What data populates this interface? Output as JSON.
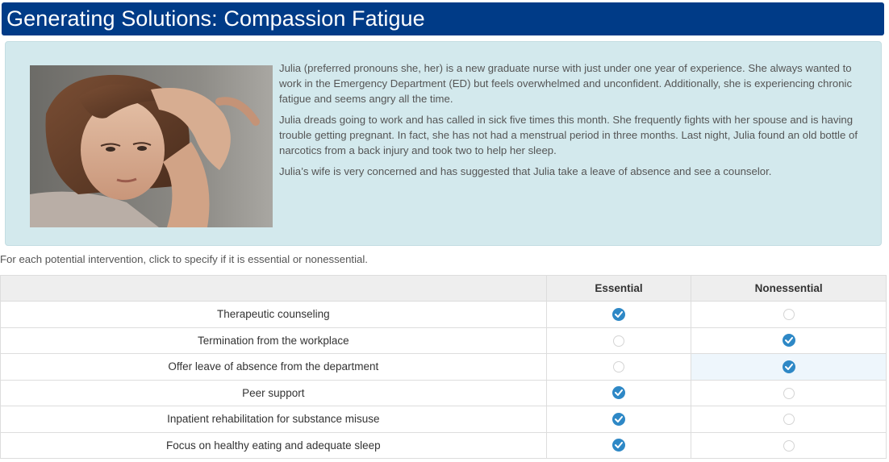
{
  "header": {
    "title": "Generating Solutions: Compassion Fatigue"
  },
  "scenario": {
    "image": "distressed-woman-photo",
    "paragraphs": [
      "Julia (preferred pronouns she, her) is a new graduate nurse with just under one year of experience. She always wanted to work in the Emergency Department (ED) but feels overwhelmed and unconfident. Additionally, she is experiencing chronic fatigue and seems angry all the time.",
      "Julia dreads going to work and has called in sick five times this month. She frequently fights with her spouse and is having trouble getting pregnant. In fact, she has not had a menstrual period in three months. Last night, Julia found an old bottle of narcotics from a back injury and took two to help her sleep.",
      "Julia’s wife is very concerned and has suggested that Julia take a leave of absence and see a counselor."
    ]
  },
  "instructions": "For each potential intervention, click to specify if it is essential or nonessential.",
  "grid": {
    "columns": [
      "",
      "Essential",
      "Nonessential"
    ],
    "rows": [
      {
        "label": "Therapeutic counseling",
        "selected": "Essential"
      },
      {
        "label": "Termination from the workplace",
        "selected": "Nonessential"
      },
      {
        "label": "Offer leave of absence from the department",
        "selected": "Nonessential"
      },
      {
        "label": "Peer support",
        "selected": "Essential"
      },
      {
        "label": "Inpatient rehabilitation for substance misuse",
        "selected": "Essential"
      },
      {
        "label": "Focus on healthy eating and adequate sleep",
        "selected": "Essential"
      }
    ]
  },
  "colors": {
    "title_bar": "#003b87",
    "panel_background": "#d3e9ed",
    "radio_checked": "#2e88c6"
  }
}
